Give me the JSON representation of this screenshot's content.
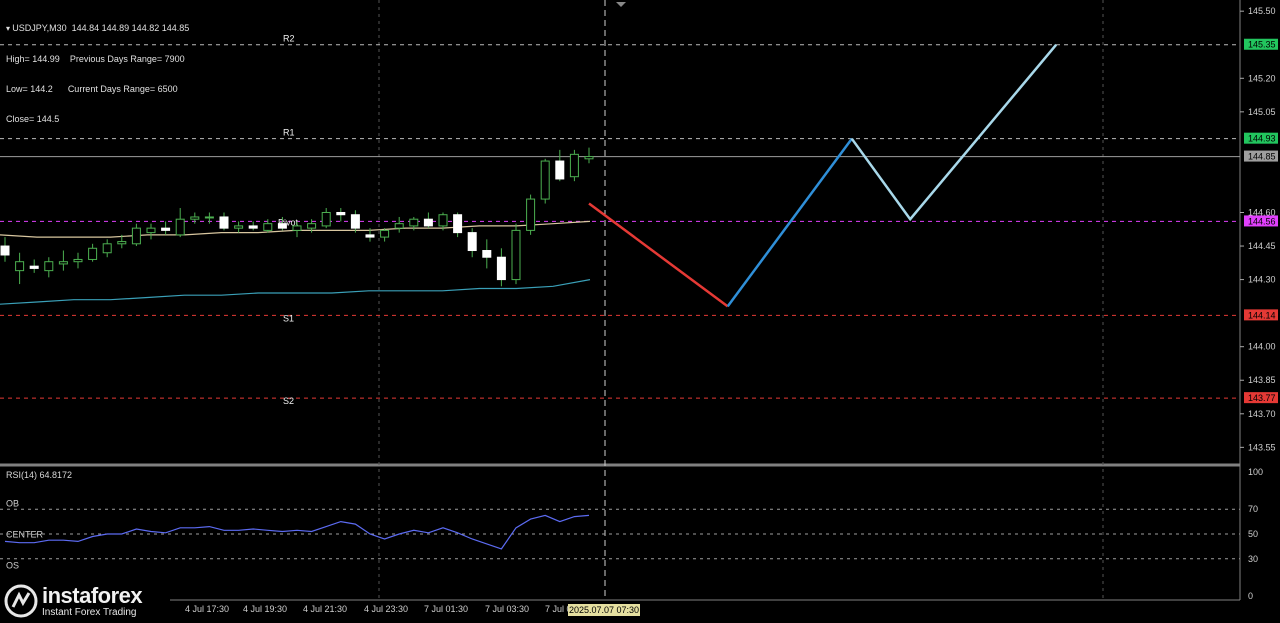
{
  "window": {
    "symbol": "USDJPY,M30",
    "ohlc_header": "144.84 144.89 144.82 144.85",
    "high_line": "High= 144.99",
    "prev_range": "Previous Days Range= 7900",
    "low_line": "Low= 144.2",
    "curr_range": "Current Days Range= 6500",
    "close_line": "Close= 144.5"
  },
  "price_axis": {
    "ticks": [
      "145.50",
      "145.35",
      "145.20",
      "145.05",
      "144.93",
      "144.85",
      "144.60",
      "144.56",
      "144.45",
      "144.30",
      "144.14",
      "144.00",
      "143.85",
      "143.77",
      "143.70",
      "143.55"
    ],
    "min": 143.48,
    "max": 145.55
  },
  "levels": [
    {
      "label": "R2",
      "price": 145.35,
      "tag": "145.35",
      "color": "#22c55e"
    },
    {
      "label": "R1",
      "price": 144.93,
      "tag": "144.93",
      "color": "#22c55e"
    },
    {
      "label": "Pivot",
      "price": 144.56,
      "tag": "144.56",
      "color": "#e040fb"
    },
    {
      "label": "S1",
      "price": 144.14,
      "tag": "144.14",
      "color": "#e53935"
    },
    {
      "label": "S2",
      "price": 143.77,
      "tag": "143.77",
      "color": "#e53935"
    }
  ],
  "current_price": {
    "value": 144.85,
    "tag": "144.85",
    "color": "#9e9e9e"
  },
  "candles": [
    {
      "o": 144.45,
      "h": 144.49,
      "l": 144.38,
      "c": 144.41
    },
    {
      "o": 144.34,
      "h": 144.42,
      "l": 144.28,
      "c": 144.38
    },
    {
      "o": 144.36,
      "h": 144.39,
      "l": 144.33,
      "c": 144.35
    },
    {
      "o": 144.34,
      "h": 144.4,
      "l": 144.31,
      "c": 144.38
    },
    {
      "o": 144.37,
      "h": 144.43,
      "l": 144.34,
      "c": 144.38
    },
    {
      "o": 144.38,
      "h": 144.42,
      "l": 144.35,
      "c": 144.39
    },
    {
      "o": 144.39,
      "h": 144.46,
      "l": 144.38,
      "c": 144.44
    },
    {
      "o": 144.42,
      "h": 144.48,
      "l": 144.4,
      "c": 144.46
    },
    {
      "o": 144.46,
      "h": 144.5,
      "l": 144.44,
      "c": 144.47
    },
    {
      "o": 144.46,
      "h": 144.55,
      "l": 144.45,
      "c": 144.53
    },
    {
      "o": 144.51,
      "h": 144.55,
      "l": 144.48,
      "c": 144.53
    },
    {
      "o": 144.53,
      "h": 144.56,
      "l": 144.5,
      "c": 144.52
    },
    {
      "o": 144.5,
      "h": 144.62,
      "l": 144.49,
      "c": 144.57
    },
    {
      "o": 144.57,
      "h": 144.6,
      "l": 144.55,
      "c": 144.58
    },
    {
      "o": 144.58,
      "h": 144.6,
      "l": 144.55,
      "c": 144.58
    },
    {
      "o": 144.58,
      "h": 144.6,
      "l": 144.52,
      "c": 144.53
    },
    {
      "o": 144.53,
      "h": 144.56,
      "l": 144.51,
      "c": 144.54
    },
    {
      "o": 144.54,
      "h": 144.56,
      "l": 144.52,
      "c": 144.53
    },
    {
      "o": 144.52,
      "h": 144.57,
      "l": 144.51,
      "c": 144.55
    },
    {
      "o": 144.55,
      "h": 144.58,
      "l": 144.52,
      "c": 144.53
    },
    {
      "o": 144.52,
      "h": 144.56,
      "l": 144.49,
      "c": 144.54
    },
    {
      "o": 144.53,
      "h": 144.57,
      "l": 144.51,
      "c": 144.55
    },
    {
      "o": 144.54,
      "h": 144.62,
      "l": 144.53,
      "c": 144.6
    },
    {
      "o": 144.6,
      "h": 144.62,
      "l": 144.56,
      "c": 144.59
    },
    {
      "o": 144.59,
      "h": 144.61,
      "l": 144.51,
      "c": 144.53
    },
    {
      "o": 144.5,
      "h": 144.53,
      "l": 144.47,
      "c": 144.49
    },
    {
      "o": 144.49,
      "h": 144.53,
      "l": 144.47,
      "c": 144.52
    },
    {
      "o": 144.53,
      "h": 144.58,
      "l": 144.51,
      "c": 144.55
    },
    {
      "o": 144.54,
      "h": 144.58,
      "l": 144.52,
      "c": 144.57
    },
    {
      "o": 144.57,
      "h": 144.6,
      "l": 144.53,
      "c": 144.54
    },
    {
      "o": 144.54,
      "h": 144.6,
      "l": 144.52,
      "c": 144.59
    },
    {
      "o": 144.59,
      "h": 144.6,
      "l": 144.49,
      "c": 144.51
    },
    {
      "o": 144.51,
      "h": 144.53,
      "l": 144.4,
      "c": 144.43
    },
    {
      "o": 144.43,
      "h": 144.48,
      "l": 144.35,
      "c": 144.4
    },
    {
      "o": 144.4,
      "h": 144.44,
      "l": 144.27,
      "c": 144.3
    },
    {
      "o": 144.3,
      "h": 144.55,
      "l": 144.28,
      "c": 144.52
    },
    {
      "o": 144.52,
      "h": 144.68,
      "l": 144.5,
      "c": 144.66
    },
    {
      "o": 144.66,
      "h": 144.84,
      "l": 144.64,
      "c": 144.83
    },
    {
      "o": 144.83,
      "h": 144.88,
      "l": 144.74,
      "c": 144.75
    },
    {
      "o": 144.76,
      "h": 144.88,
      "l": 144.74,
      "c": 144.86
    },
    {
      "o": 144.84,
      "h": 144.89,
      "l": 144.82,
      "c": 144.85
    }
  ],
  "ma_slow": [
    144.5,
    144.49,
    144.49,
    144.49,
    144.5,
    144.5,
    144.51,
    144.51,
    144.52,
    144.52,
    144.52,
    144.53,
    144.53,
    144.54,
    144.54,
    144.55,
    144.56
  ],
  "ma_fast": [
    144.19,
    144.2,
    144.21,
    144.21,
    144.22,
    144.23,
    144.23,
    144.24,
    144.24,
    144.24,
    144.25,
    144.25,
    144.25,
    144.26,
    144.26,
    144.27,
    144.3
  ],
  "projections": [
    {
      "name": "red-wave",
      "color": "#e53935",
      "points": [
        [
          40,
          144.64
        ],
        [
          49.5,
          144.18
        ]
      ]
    },
    {
      "name": "blue-wave",
      "color": "#2f8fd8",
      "points": [
        [
          49.5,
          144.18
        ],
        [
          58,
          144.93
        ]
      ]
    },
    {
      "name": "lightblue-wave",
      "color": "#a8d8ea",
      "points": [
        [
          58,
          144.93
        ],
        [
          62,
          144.57
        ],
        [
          72,
          145.35
        ]
      ]
    }
  ],
  "rsi": {
    "label": "RSI(14) 64.8172",
    "levels": {
      "OB": "OB",
      "CENTER": "CENTER",
      "OS": "OS"
    },
    "ticks": [
      "100",
      "70",
      "50",
      "30",
      "0"
    ],
    "values": [
      44,
      43,
      43,
      45,
      45,
      44,
      48,
      50,
      50,
      54,
      52,
      51,
      55,
      55,
      56,
      53,
      53,
      54,
      53,
      52,
      53,
      52,
      56,
      60,
      58,
      50,
      46,
      50,
      53,
      51,
      55,
      51,
      46,
      42,
      38,
      55,
      62,
      65,
      60,
      64,
      65
    ]
  },
  "time_axis": [
    "4 Jul 17:30",
    "4 Jul 19:30",
    "4 Jul 21:30",
    "4 Jul 23:30",
    "7 Jul 01:30",
    "7 Jul 03:30",
    "7 Jul 0"
  ],
  "cursor_date": "2025.07.07 07:30",
  "logo": {
    "brand": "instaforex",
    "tagline": "Instant Forex Trading"
  }
}
